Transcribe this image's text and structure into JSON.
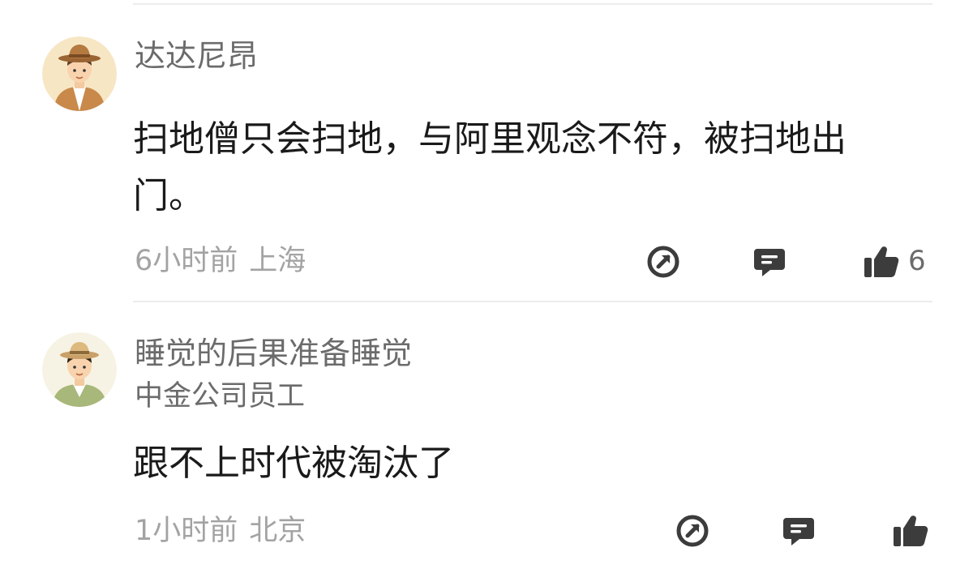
{
  "comments": [
    {
      "author": "达达尼昂",
      "avatar_icon": "avatar-brown-hat",
      "text": "扫地僧只会扫地，与阿里观念不符，被扫地出门。",
      "time": "6小时前",
      "location": "上海",
      "like_count": "6"
    },
    {
      "author": "睡觉的后果准备睡觉",
      "avatar_icon": "avatar-green-hat",
      "title": "中金公司员工",
      "text": "跟不上时代被淘汰了",
      "time": "1小时前",
      "location": "北京",
      "like_count": ""
    }
  ],
  "icons": {
    "share": "share-icon",
    "reply": "comment-icon",
    "like": "thumbs-up-icon"
  },
  "colors": {
    "icon": "#3c3c3c",
    "meta_text": "#a3a3a3",
    "name_text": "#6b6b6b",
    "body_text": "#1a1a1a"
  }
}
